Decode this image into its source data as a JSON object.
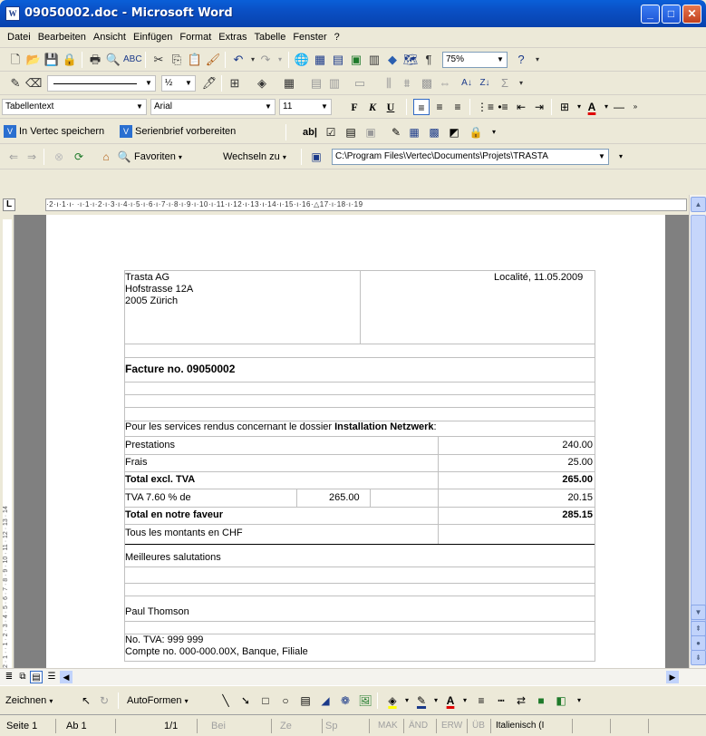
{
  "window": {
    "title": "09050002.doc - Microsoft Word",
    "doc_icon": "word-doc-icon",
    "min": "_",
    "max": "□",
    "close": "✕"
  },
  "menu": [
    "Datei",
    "Bearbeiten",
    "Ansicht",
    "Einfügen",
    "Format",
    "Extras",
    "Tabelle",
    "Fenster",
    "?"
  ],
  "standard_toolbar": {
    "zoom": "75%",
    "paragraph_mark": "¶"
  },
  "drawing_line": {
    "width": "½"
  },
  "format_toolbar": {
    "style": "Tabellentext",
    "font": "Arial",
    "size": "11",
    "bold": "F",
    "italic": "K",
    "underline": "U"
  },
  "vertec_toolbar": {
    "save_label": "In Vertec speichern",
    "mail_label": "Serienbrief vorbereiten",
    "field_label": "ab|"
  },
  "web_toolbar": {
    "favorites": "Favoriten",
    "switch_to": "Wechseln zu",
    "address": "C:\\Program Files\\Vertec\\Documents\\Projets\\TRASTA"
  },
  "ruler": {
    "h_numbers": "·2·ı·1·ı· ·ı·1·ı·2·ı·3·ı·4·ı·5·ı·6·ı·7·ı·8·ı·9·ı·10·ı·11·ı·12·ı·13·ı·14·ı·15·ı·16·△17·ı·18·ı·19",
    "v_numbers": "2 · 1 · · 1 · 2 · 3 · 4 · 5 · 6 · 7 · 8 · 9 · 10 · 11 · 12 · 13 · 14"
  },
  "letter": {
    "sender_name": "Trasta AG",
    "sender_street": "Hofstrasse 12A",
    "sender_city": "2005 Zürich",
    "place_date": "Localité, 11.05.2009",
    "invoice_title": "Facture no. 09050002",
    "intro_prefix": "Pour les services rendus concernant le dossier ",
    "intro_dossier": "Installation Netzwerk",
    "intro_suffix": ":",
    "rows": [
      {
        "label": "Prestations",
        "amount": "240.00",
        "bold": false
      },
      {
        "label": "Frais",
        "amount": "25.00",
        "bold": false
      },
      {
        "label": "Total excl. TVA",
        "amount": "265.00",
        "bold": true
      },
      {
        "label": "TVA 7.60 % de",
        "base": "265.00",
        "amount": "20.15",
        "bold": false
      },
      {
        "label": "Total en notre faveur",
        "amount": "285.15",
        "bold": true
      },
      {
        "label": "Tous les montants en CHF",
        "amount": "",
        "bold": false
      }
    ],
    "greeting": "Meilleures salutations",
    "signer": "Paul Thomson",
    "vat_no": "No. TVA: 999 999",
    "account": "Compte no. 000-000.00X, Banque, Filiale"
  },
  "drawing_toolbar": {
    "draw": "Zeichnen",
    "autoshapes": "AutoFormen"
  },
  "status": {
    "page": "Seite 1",
    "section": "Ab 1",
    "pages": "1/1",
    "at": "Bei",
    "line": "Ze",
    "col": "Sp",
    "rec": "MAK",
    "trk": "ÄND",
    "ext": "ERW",
    "ovr": "ÜB",
    "lang": "Italienisch (I"
  }
}
